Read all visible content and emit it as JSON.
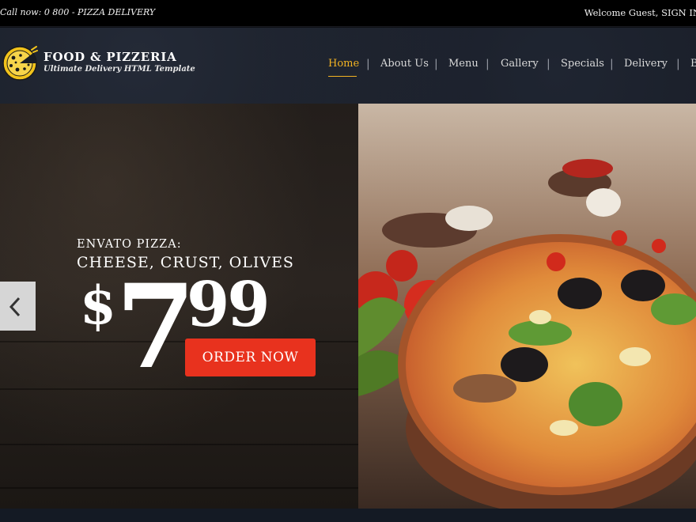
{
  "topbar": {
    "call_text": "Call now: 0 800 - PIZZA DELIVERY",
    "welcome_text": "Welcome Guest, SIGN IN"
  },
  "brand": {
    "name": "FOOD & PIZZERIA",
    "tagline": "Ultimate Delivery HTML Template",
    "logo_icon": "pizza-icon",
    "logo_color": "#f2c31b"
  },
  "nav": {
    "items": [
      {
        "label": "Home",
        "active": true
      },
      {
        "label": "About Us"
      },
      {
        "label": "Menu"
      },
      {
        "label": "Gallery"
      },
      {
        "label": "Specials"
      },
      {
        "label": "Delivery"
      },
      {
        "label": "B"
      }
    ],
    "separator": "|",
    "active_color": "#f2b323"
  },
  "slide": {
    "kicker": "ENVATO PIZZA:",
    "title": "CHEESE, CRUST, OLIVES",
    "price_currency": "$",
    "price_main": "7",
    "price_cents": "99",
    "order_button": "ORDER NOW",
    "order_button_color": "#e8321e",
    "prev_icon": "chevron-left-icon"
  }
}
